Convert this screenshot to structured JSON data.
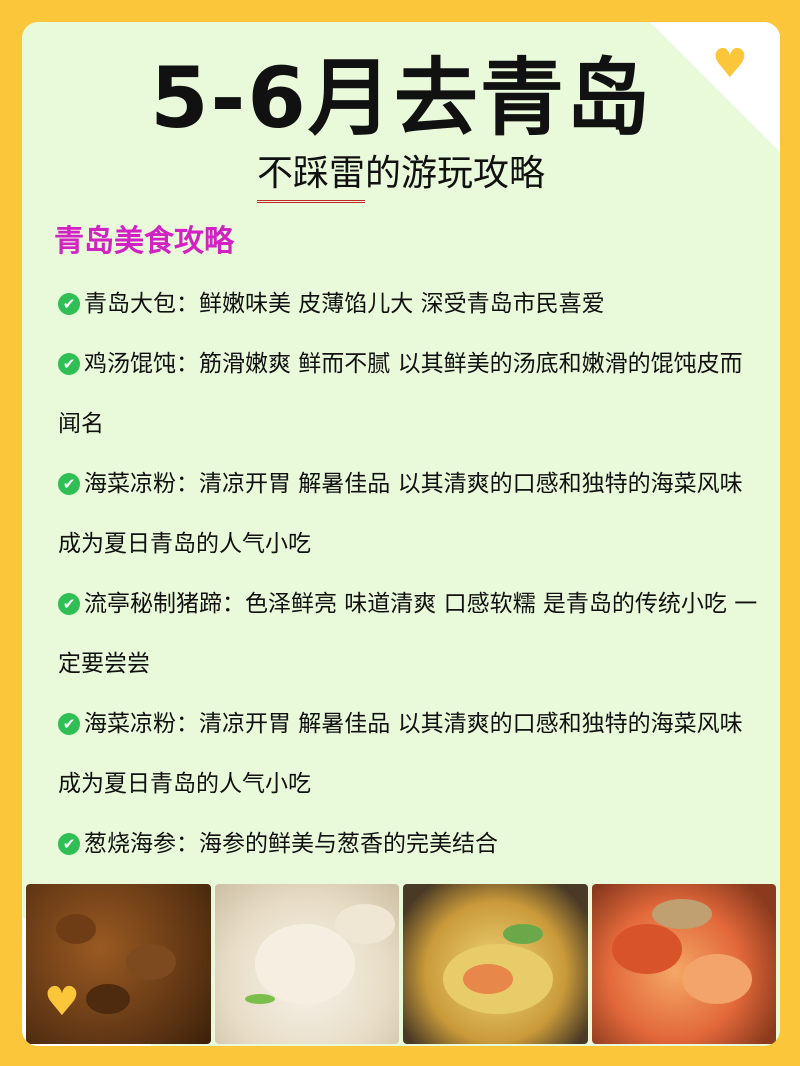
{
  "title": "5-6月去青岛",
  "subtitle": {
    "underlined": "不踩雷",
    "rest": "的游玩攻略"
  },
  "section_title": "青岛美食攻略",
  "items": [
    "青岛大包：鲜嫩味美 皮薄馅儿大 深受青岛市民喜爱",
    "鸡汤馄饨：筋滑嫩爽 鲜而不腻 以其鲜美的汤底和嫩滑的馄饨皮而闻名",
    "海菜凉粉：清凉开胃 解暑佳品 以其清爽的口感和独特的海菜风味成为夏日青岛的人气小吃",
    "流亭秘制猪蹄：色泽鲜亮 味道清爽 口感软糯 是青岛的传统小吃 一定要尝尝",
    "海菜凉粉：清凉开胃 解暑佳品 以其清爽的口感和独特的海菜风味成为夏日青岛的人气小吃",
    "葱烧海参：海参的鲜美与葱香的完美结合"
  ],
  "icons": {
    "check": "✔",
    "heart": "♥"
  },
  "colors": {
    "background": "#fcc63a",
    "card": "#e9fadb",
    "section_title": "#d322c3",
    "check": "#2fbf54",
    "underline": "#c22828"
  }
}
